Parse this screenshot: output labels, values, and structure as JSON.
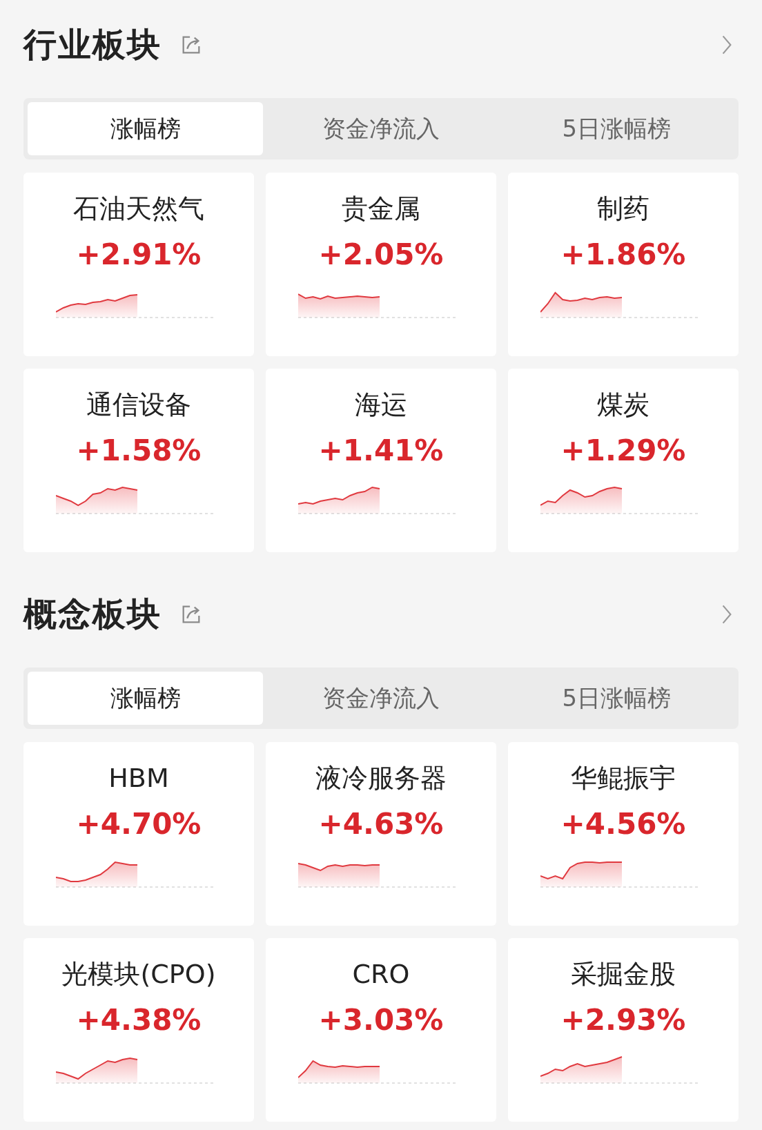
{
  "sections": [
    {
      "title": "行业板块",
      "tabs": [
        {
          "label": "涨幅榜",
          "selected": true
        },
        {
          "label": "资金净流入",
          "selected": false
        },
        {
          "label": "5日涨幅榜",
          "selected": false
        }
      ],
      "cards": [
        {
          "name": "石油天然气",
          "change": "+2.91%"
        },
        {
          "name": "贵金属",
          "change": "+2.05%"
        },
        {
          "name": "制药",
          "change": "+1.86%"
        },
        {
          "name": "通信设备",
          "change": "+1.58%"
        },
        {
          "name": "海运",
          "change": "+1.41%"
        },
        {
          "name": "煤炭",
          "change": "+1.29%"
        }
      ]
    },
    {
      "title": "概念板块",
      "tabs": [
        {
          "label": "涨幅榜",
          "selected": true
        },
        {
          "label": "资金净流入",
          "selected": false
        },
        {
          "label": "5日涨幅榜",
          "selected": false
        }
      ],
      "cards": [
        {
          "name": "HBM",
          "change": "+4.70%"
        },
        {
          "name": "液冷服务器",
          "change": "+4.63%"
        },
        {
          "name": "华鲲振宇",
          "change": "+4.56%"
        },
        {
          "name": "光模块(CPO)",
          "change": "+4.38%"
        },
        {
          "name": "CRO",
          "change": "+3.03%"
        },
        {
          "name": "采掘金股",
          "change": "+2.93%"
        }
      ]
    }
  ]
}
